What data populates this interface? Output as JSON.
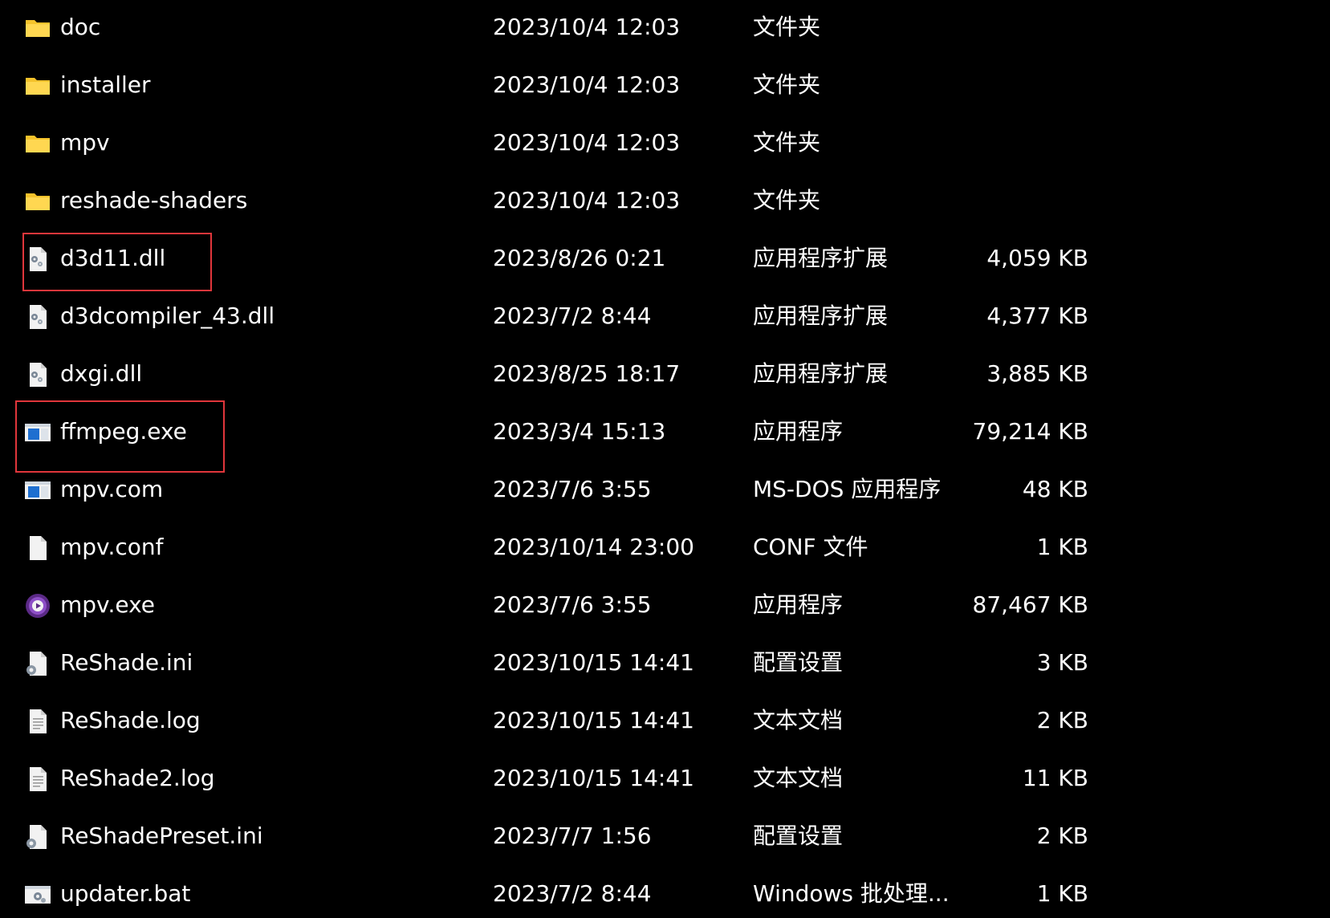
{
  "highlight_color": "#e0363b",
  "files": [
    {
      "name": "doc",
      "date": "2023/10/4 12:03",
      "type": "文件夹",
      "size": "",
      "icon": "folder-icon"
    },
    {
      "name": "installer",
      "date": "2023/10/4 12:03",
      "type": "文件夹",
      "size": "",
      "icon": "folder-icon"
    },
    {
      "name": "mpv",
      "date": "2023/10/4 12:03",
      "type": "文件夹",
      "size": "",
      "icon": "folder-icon"
    },
    {
      "name": "reshade-shaders",
      "date": "2023/10/4 12:03",
      "type": "文件夹",
      "size": "",
      "icon": "folder-icon"
    },
    {
      "name": "d3d11.dll",
      "date": "2023/8/26 0:21",
      "type": "应用程序扩展",
      "size": "4,059 KB",
      "icon": "dll-file-icon"
    },
    {
      "name": "d3dcompiler_43.dll",
      "date": "2023/7/2 8:44",
      "type": "应用程序扩展",
      "size": "4,377 KB",
      "icon": "dll-file-icon"
    },
    {
      "name": "dxgi.dll",
      "date": "2023/8/25 18:17",
      "type": "应用程序扩展",
      "size": "3,885 KB",
      "icon": "dll-file-icon"
    },
    {
      "name": "ffmpeg.exe",
      "date": "2023/3/4 15:13",
      "type": "应用程序",
      "size": "79,214 KB",
      "icon": "exe-window-icon"
    },
    {
      "name": "mpv.com",
      "date": "2023/7/6 3:55",
      "type": "MS-DOS 应用程序",
      "size": "48 KB",
      "icon": "exe-window-icon"
    },
    {
      "name": "mpv.conf",
      "date": "2023/10/14 23:00",
      "type": "CONF 文件",
      "size": "1 KB",
      "icon": "blank-file-icon"
    },
    {
      "name": "mpv.exe",
      "date": "2023/7/6 3:55",
      "type": "应用程序",
      "size": "87,467 KB",
      "icon": "mpv-player-icon"
    },
    {
      "name": "ReShade.ini",
      "date": "2023/10/15 14:41",
      "type": "配置设置",
      "size": "3 KB",
      "icon": "settings-file-icon"
    },
    {
      "name": "ReShade.log",
      "date": "2023/10/15 14:41",
      "type": "文本文档",
      "size": "2 KB",
      "icon": "text-file-icon"
    },
    {
      "name": "ReShade2.log",
      "date": "2023/10/15 14:41",
      "type": "文本文档",
      "size": "11 KB",
      "icon": "text-file-icon"
    },
    {
      "name": "ReShadePreset.ini",
      "date": "2023/7/7 1:56",
      "type": "配置设置",
      "size": "2 KB",
      "icon": "settings-file-icon"
    },
    {
      "name": "updater.bat",
      "date": "2023/7/2 8:44",
      "type": "Windows 批处理...",
      "size": "1 KB",
      "icon": "batch-file-icon"
    }
  ]
}
